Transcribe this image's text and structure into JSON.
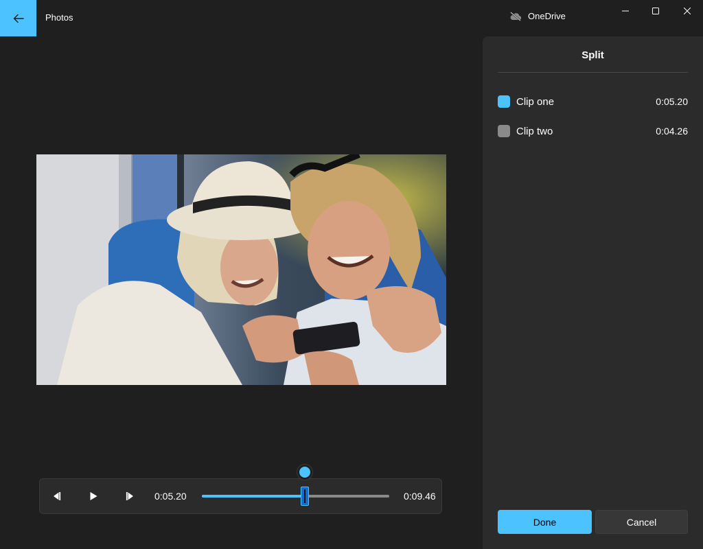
{
  "app": {
    "title": "Photos",
    "cloud_status": "OneDrive",
    "accent_color": "#4cc2ff"
  },
  "window_controls": [
    "minimize-icon",
    "maximize-icon",
    "close-icon"
  ],
  "player": {
    "current_time": "0:05.20",
    "total_time": "0:09.46",
    "split_fraction": 0.55
  },
  "split_panel": {
    "title": "Split",
    "clips": [
      {
        "name": "Clip one",
        "duration": "0:05.20",
        "color": "#4cc2ff"
      },
      {
        "name": "Clip two",
        "duration": "0:04.26",
        "color": "#8a8a8a"
      }
    ],
    "done_label": "Done",
    "cancel_label": "Cancel"
  }
}
